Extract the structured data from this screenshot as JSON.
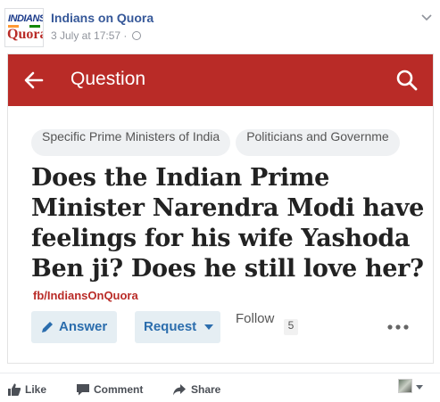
{
  "post": {
    "page_name": "Indians on Quora",
    "timestamp": "3 July at 17:57",
    "separator": "·",
    "avatar": {
      "logo_top": "INDIANS",
      "logo_bottom": "Quora"
    }
  },
  "question_screen": {
    "header_title": "Question",
    "topics": [
      "Specific Prime Ministers of India",
      "Politicians and Governme"
    ],
    "title": "Does the Indian Prime Minister Narendra Modi have feelings for his wife Yashoda Ben ji? Does he still love her?",
    "watermark": "fb/IndiansOnQuora",
    "actions": {
      "answer_label": "Answer",
      "request_label": "Request",
      "follow_label": "Follow",
      "follow_count": "5"
    },
    "colors": {
      "header_bg": "#b92b27",
      "button_bg": "#e5eef3",
      "button_text": "#2b6dad"
    }
  },
  "fb_actions": {
    "like_label": "Like",
    "comment_label": "Comment",
    "share_label": "Share"
  },
  "icons": [
    "back-arrow-icon",
    "search-icon",
    "pencil-icon",
    "caret-down-icon",
    "more-icon",
    "globe-icon",
    "thumbs-up-icon",
    "comment-icon",
    "share-icon",
    "chevron-down-icon"
  ]
}
